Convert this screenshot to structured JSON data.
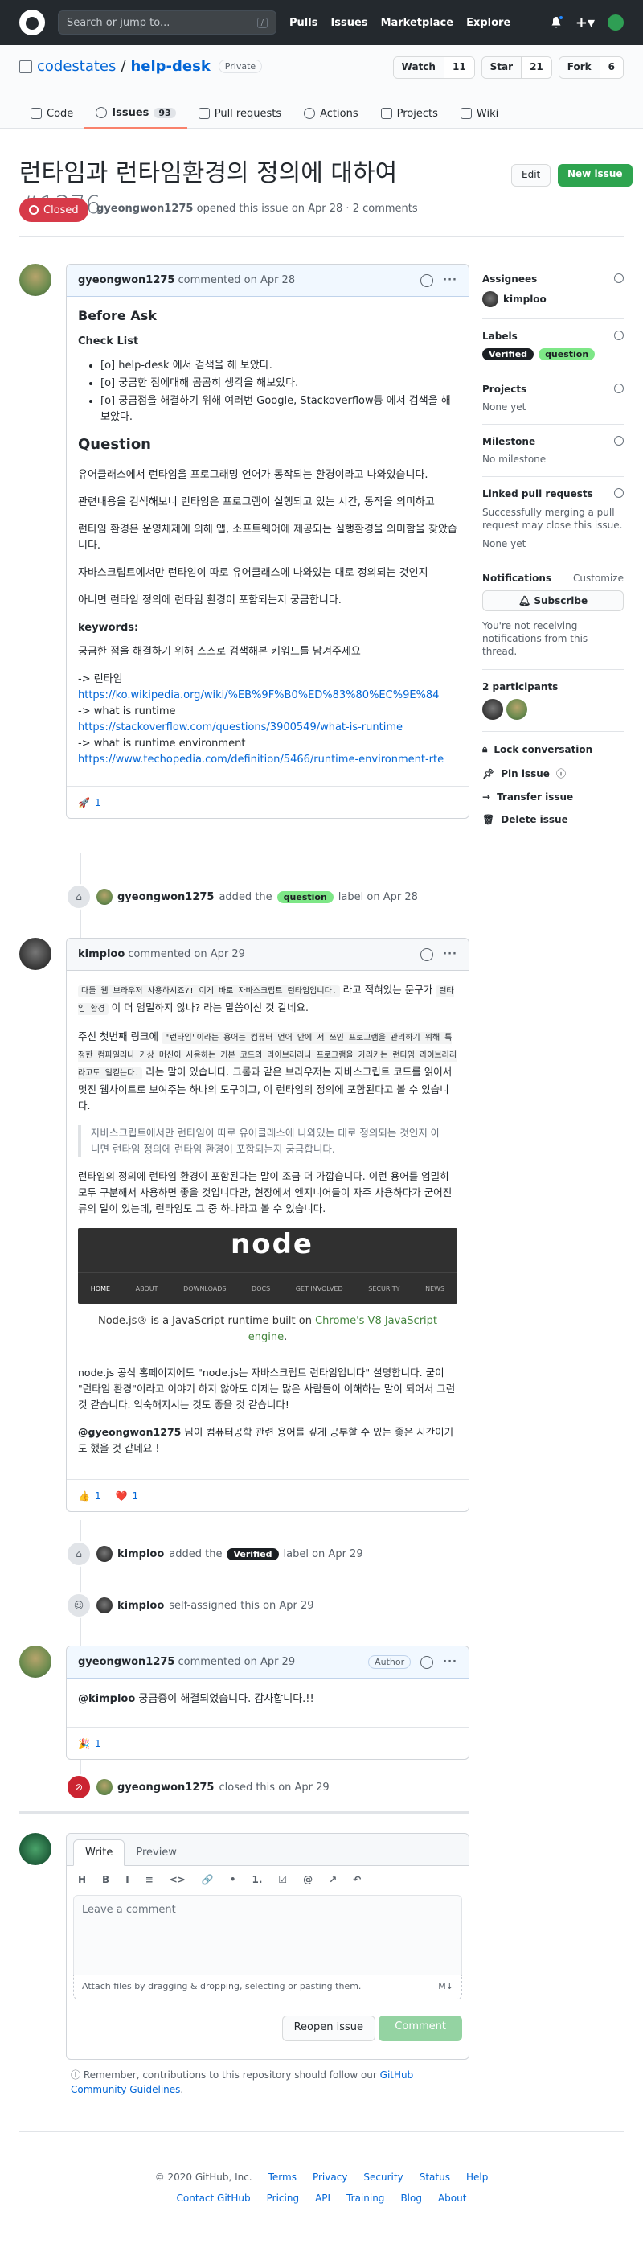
{
  "header": {
    "search_placeholder": "Search or jump to...",
    "slash_key": "/",
    "nav": [
      "Pulls",
      "Issues",
      "Marketplace",
      "Explore"
    ]
  },
  "repo": {
    "owner": "codestates",
    "name": "help-desk",
    "visibility": "Private",
    "watch_label": "Watch",
    "watch_count": "11",
    "star_label": "Star",
    "star_count": "21",
    "fork_label": "Fork",
    "fork_count": "6",
    "tabs": [
      {
        "label": "Code"
      },
      {
        "label": "Issues",
        "count": "93"
      },
      {
        "label": "Pull requests"
      },
      {
        "label": "Actions"
      },
      {
        "label": "Projects"
      },
      {
        "label": "Wiki"
      }
    ]
  },
  "issue": {
    "title": "런타임과 런타임환경의 정의에 대하여",
    "number": "#1376",
    "edit_label": "Edit",
    "new_label": "New issue",
    "state": "Closed",
    "author": "gyeongwon1275",
    "meta_text": "opened this issue on Apr 28 · 2 comments"
  },
  "comment1": {
    "author": "gyeongwon1275",
    "action": "commented on Apr 28",
    "h_before": "Before Ask",
    "h_check": "Check List",
    "checks": [
      "[o] help-desk 에서 검색을 해 보았다.",
      "[o] 궁금한 점에대해 곰곰히 생각을 해보았다.",
      "[o] 궁금점을 해결하기 위해 여러번 Google, Stackoverflow등 에서 검색을 해보았다."
    ],
    "h_question": "Question",
    "paras": [
      "유어클래스에서 런타임을 프로그래밍 언어가 동작되는 환경이라고 나와있습니다.",
      "관련내용을 검색해보니 런타임은 프로그램이 실행되고 있는 시간, 동작을 의미하고",
      "런타임 환경은 운영체제에 의해 앱, 소프트웨어에 제공되는 실행환경을 의미함을 찾았습니다.",
      "자바스크립트에서만 런타임이 따로 유어클래스에 나와있는 대로 정의되는 것인지",
      "아니면 런타임 정의에 런타임 환경이 포함되는지 궁금합니다."
    ],
    "h_keywords": "keywords:",
    "kw_text": "궁금한 점을 해결하기 위해 스스로 검색해본 키워드를 남겨주세요",
    "links": [
      {
        "label": "-> 런타임",
        "url": "https://ko.wikipedia.org/wiki/%EB%9F%B0%ED%83%80%EC%9E%84"
      },
      {
        "label": "-> what is runtime",
        "url": "https://stackoverflow.com/questions/3900549/what-is-runtime"
      },
      {
        "label": "-> what is runtime environment",
        "url": "https://www.techopedia.com/definition/5466/runtime-environment-rte"
      }
    ],
    "reaction_emoji": "🚀",
    "reaction_count": "1"
  },
  "event1": {
    "user": "gyeongwon1275",
    "pre": "added the",
    "label": "question",
    "post": "label on Apr 28"
  },
  "comment2": {
    "author": "kimploo",
    "action": "commented on Apr 29",
    "p1_code": "다들 웹 브라우저 사용하시죠?! 이게 바로 자바스크립트 런타임입니다.",
    "p1_mid": " 라고 적혀있는 문구가 ",
    "p1_code2": "런타임 환경",
    "p1_end": " 이 더 엄밀하지 않나? 라는 말씀이신 것 같네요.",
    "p2_start": "주신 첫번째 링크에 ",
    "p2_code": "\"런타임\"이라는 용어는 컴퓨터 언어 안에 서 쓰인 프로그램을 관리하기 위해 특정한 컴파일러나 가상 머신이 사용하는 기본 코드의 라이브러리나 프로그램을 가리키는 런타임 라이브러리라고도 일컫는다.",
    "p2_end": " 라는 말이 있습니다. 크롬과 같은 브라우저는 자바스크립트 코드를 읽어서 멋진 웹사이트로 보여주는 하나의 도구이고, 이 런타임의 정의에 포함된다고 볼 수 있습니다.",
    "quote": "자바스크립트에서만 런타임이 따로 유어클래스에 나와있는 대로 정의되는 것인지 아니면 런타임 정의에 런타임 환경이 포함되는지 궁금합니다.",
    "p3": "런타임의 정의에 런타임 환경이 포함된다는 말이 조금 더 가깝습니다. 이런 용어를 엄밀히 모두 구분해서 사용하면 좋을 것입니다만, 현장에서 엔지니어들이 자주 사용하다가 굳어진 류의 말이 있는데, 런타임도 그 중 하나라고 볼 수 있습니다.",
    "node_logo": "node",
    "node_nav": [
      "HOME",
      "ABOUT",
      "DOWNLOADS",
      "DOCS",
      "GET INVOLVED",
      "SECURITY",
      "NEWS"
    ],
    "node_caption_pre": "Node.js® is a JavaScript runtime built on ",
    "node_caption_link": "Chrome's V8 JavaScript engine",
    "node_caption_post": ".",
    "p4": "node.js 공식 홈페이지에도 \"node.js는 자바스크립트 런타임입니다\" 설명합니다. 굳이 \"런타임 환경\"이라고 이야기 하지 않아도 이제는 많은 사람들이 이해하는 말이 되어서 그런 것 같습니다. 익숙해지시는 것도 좋을 것 같습니다!",
    "p5_mention": "@gyeongwon1275",
    "p5_text": " 님이 컴퓨터공학 관련 용어를 깊게 공부할 수 있는 좋은 시간이기도 했을 것 같네요 !",
    "reactions": [
      {
        "emoji": "👍",
        "count": "1"
      },
      {
        "emoji": "❤️",
        "count": "1"
      }
    ]
  },
  "event2": {
    "user": "kimploo",
    "pre": "added the",
    "label": "Verified",
    "post": "label on Apr 29"
  },
  "event3": {
    "user": "kimploo",
    "text": "self-assigned this on Apr 29"
  },
  "comment3": {
    "author": "gyeongwon1275",
    "action": "commented on Apr 29",
    "badge": "Author",
    "mention": "@kimploo",
    "text": " 궁금증이 해결되었습니다. 감사합니다.!!",
    "reaction_emoji": "🎉",
    "reaction_count": "1"
  },
  "event4": {
    "user": "gyeongwon1275",
    "text": "closed this on Apr 29"
  },
  "editor": {
    "tab_write": "Write",
    "tab_preview": "Preview",
    "tools": [
      "H",
      "B",
      "I",
      "≡",
      "<>",
      "🔗",
      "•",
      "1.",
      "☑",
      "@",
      "↗",
      "↶"
    ],
    "placeholder": "Leave a comment",
    "attach_text": "Attach files by dragging & dropping, selecting or pasting them.",
    "reopen_label": "Reopen issue",
    "comment_label": "Comment"
  },
  "reminder": {
    "text": "Remember, contributions to this repository should follow our ",
    "link": "GitHub Community Guidelines",
    "post": "."
  },
  "sidebar": {
    "assignees_h": "Assignees",
    "assignee": "kimploo",
    "labels_h": "Labels",
    "labels": [
      "Verified",
      "question"
    ],
    "projects_h": "Projects",
    "projects_val": "None yet",
    "milestone_h": "Milestone",
    "milestone_val": "No milestone",
    "linked_h": "Linked pull requests",
    "linked_text": "Successfully merging a pull request may close this issue.",
    "linked_val": "None yet",
    "notif_h": "Notifications",
    "customize": "Customize",
    "subscribe": "Subscribe",
    "notif_text": "You're not receiving notifications from this thread.",
    "participants": "2 participants",
    "lock": "Lock conversation",
    "pin": "Pin issue",
    "transfer": "Transfer issue",
    "delete": "Delete issue"
  },
  "footer": {
    "copyright": "© 2020 GitHub, Inc.",
    "row1": [
      "Terms",
      "Privacy",
      "Security",
      "Status",
      "Help"
    ],
    "row2": [
      "Contact GitHub",
      "Pricing",
      "API",
      "Training",
      "Blog",
      "About"
    ]
  }
}
